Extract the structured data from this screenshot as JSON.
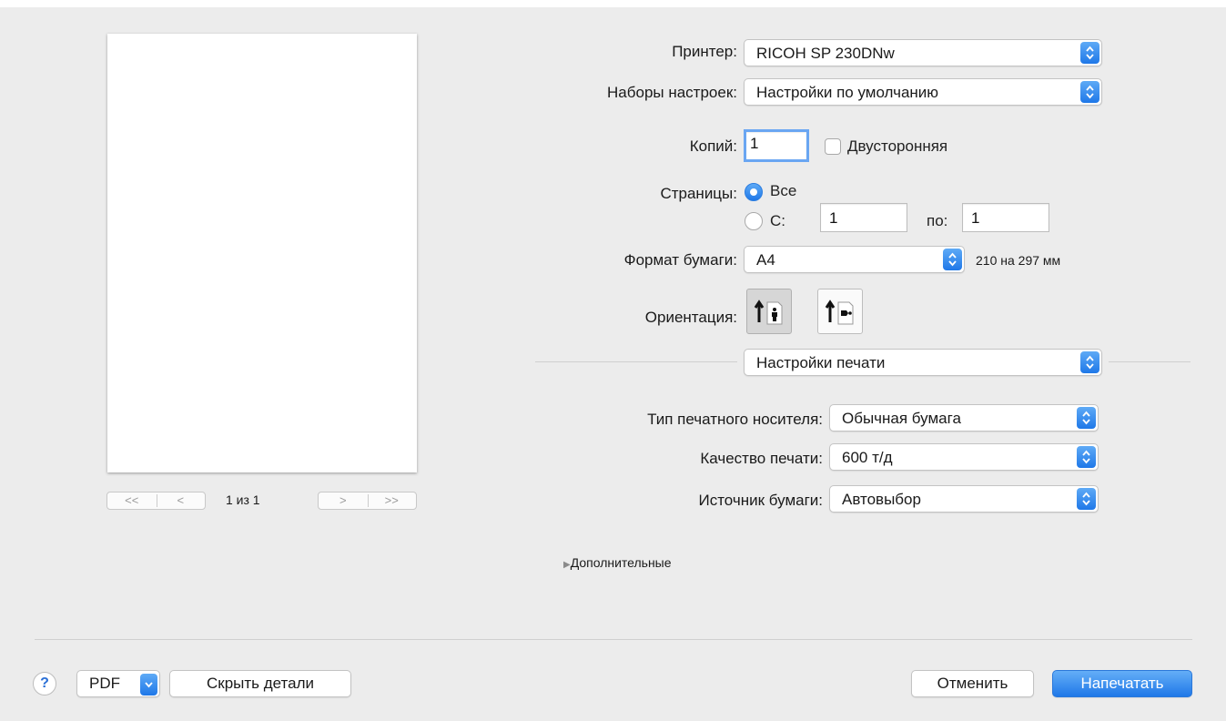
{
  "printer": {
    "label": "Принтер:",
    "value": "RICOH SP 230DNw"
  },
  "presets": {
    "label": "Наборы настроек:",
    "value": "Настройки по умолчанию"
  },
  "copies": {
    "label": "Копий:",
    "value": "1",
    "duplex_label": "Двусторонняя"
  },
  "pages": {
    "label": "Страницы:",
    "all_label": "Все",
    "from_label": "С:",
    "from_value": "1",
    "to_label": "по:",
    "to_value": "1"
  },
  "paper": {
    "label": "Формат бумаги:",
    "value": "A4",
    "size_text": "210 на 297 мм"
  },
  "orientation": {
    "label": "Ориентация:"
  },
  "section": {
    "value": "Настройки печати"
  },
  "media_type": {
    "label": "Тип печатного носителя:",
    "value": "Обычная бумага"
  },
  "quality": {
    "label": "Качество печати:",
    "value": "600 т/д"
  },
  "source": {
    "label": "Источник бумаги:",
    "value": "Автовыбор"
  },
  "advanced": {
    "label": "Дополнительные"
  },
  "preview": {
    "page_text": "1 из 1"
  },
  "footer": {
    "help": "?",
    "pdf_label": "PDF",
    "hide_details_label": "Скрыть детали",
    "cancel_label": "Отменить",
    "print_label": "Напечатать"
  },
  "colors": {
    "accent": "#1f78e8",
    "background": "#ececec"
  }
}
